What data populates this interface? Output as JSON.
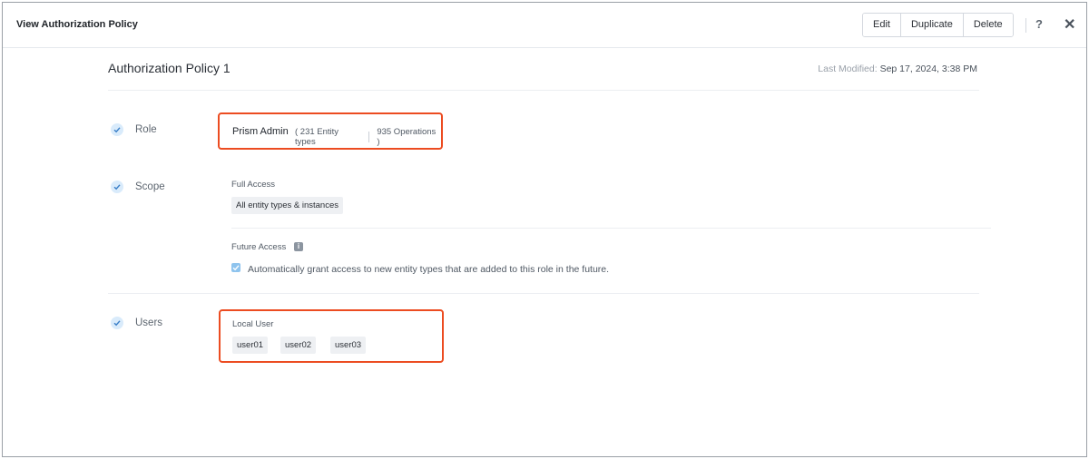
{
  "header": {
    "title": "View Authorization Policy",
    "actions": [
      "Edit",
      "Duplicate",
      "Delete"
    ],
    "help_label": "?",
    "close_label": "✕"
  },
  "policy": {
    "name": "Authorization Policy 1",
    "last_modified_label": "Last Modified:",
    "last_modified_value": "Sep 17, 2024, 3:38 PM"
  },
  "role": {
    "label": "Role",
    "name": "Prism Admin",
    "entity_types": "( 231 Entity types",
    "operations": "935 Operations )"
  },
  "scope": {
    "label": "Scope",
    "full_access_label": "Full Access",
    "full_access_value": "All entity types & instances",
    "future_access_label": "Future Access",
    "future_access_text": "Automatically grant access to new entity types that are added to this role in the future.",
    "future_access_checked": true
  },
  "users": {
    "label": "Users",
    "group_label": "Local User",
    "items": [
      "user01",
      "user02",
      "user03"
    ]
  },
  "colors": {
    "highlight": "#ec4c21",
    "check_accent": "#4a90d9"
  },
  "icons": [
    "check-icon",
    "info-icon",
    "help-icon",
    "close-icon",
    "checkbox-icon"
  ]
}
